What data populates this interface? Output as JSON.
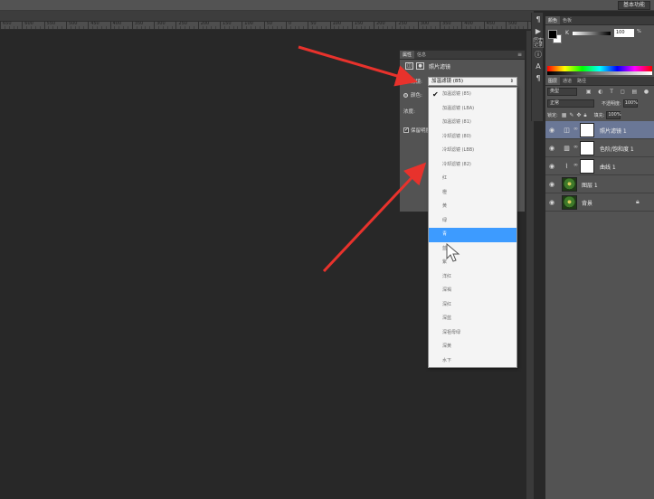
{
  "workspace": {
    "label": "基本功能"
  },
  "ruler": {
    "labels": [
      "650",
      "600",
      "550",
      "500",
      "450",
      "400",
      "350",
      "300",
      "250",
      "200",
      "150",
      "100",
      "50",
      "0",
      "50",
      "100",
      "150",
      "200",
      "250",
      "300",
      "350",
      "400",
      "450",
      "500",
      "550"
    ]
  },
  "toolstrip": {
    "items": [
      "paragraph-icon",
      "play-icon",
      "history-icon",
      "info-icon",
      "character-icon",
      "paragraph-style-icon"
    ],
    "selected_label": "历史记录"
  },
  "color_panel": {
    "tabs": [
      "颜色",
      "色板"
    ],
    "channel_label": "K",
    "value": "100",
    "unit": "%"
  },
  "layers_panel": {
    "tabs": [
      "图层",
      "通道",
      "路径"
    ],
    "kind": "类型",
    "blend_mode": "正常",
    "opacity_label": "不透明度:",
    "opacity": "100%",
    "lock_label": "锁定:",
    "fill_label": "填充:",
    "fill": "100%",
    "layers": [
      {
        "name": "照片滤镜 1",
        "type": "adjustment",
        "selected": true
      },
      {
        "name": "色阶/饱和度 1",
        "type": "adjustment",
        "selected": false
      },
      {
        "name": "曲线 1",
        "type": "adjustment",
        "selected": false
      },
      {
        "name": "图层 1",
        "type": "image",
        "selected": false
      },
      {
        "name": "背景",
        "type": "image",
        "selected": false,
        "locked": true
      }
    ]
  },
  "properties": {
    "tabs": [
      "属性",
      "信息"
    ],
    "title": "照片滤镜",
    "filter_label": "滤镜:",
    "color_label": "颜色:",
    "density_label": "浓度:",
    "preserve_label": "保留明度",
    "selected_filter": "加温滤镜 (85)"
  },
  "dropdown": {
    "items": [
      "加温滤镜 (85)",
      "加温滤镜 (LBA)",
      "加温滤镜 (81)",
      "冷却滤镜 (80)",
      "冷却滤镜 (LBB)",
      "冷却滤镜 (82)",
      "红",
      "橙",
      "黄",
      "绿",
      "青",
      "蓝",
      "紫",
      "洋红",
      "深褐",
      "深红",
      "深蓝",
      "深祖母绿",
      "深黄",
      "水下"
    ],
    "checked_index": 0,
    "highlighted_index": 10
  },
  "annotation": {
    "arrow_color": "#e8322c"
  }
}
